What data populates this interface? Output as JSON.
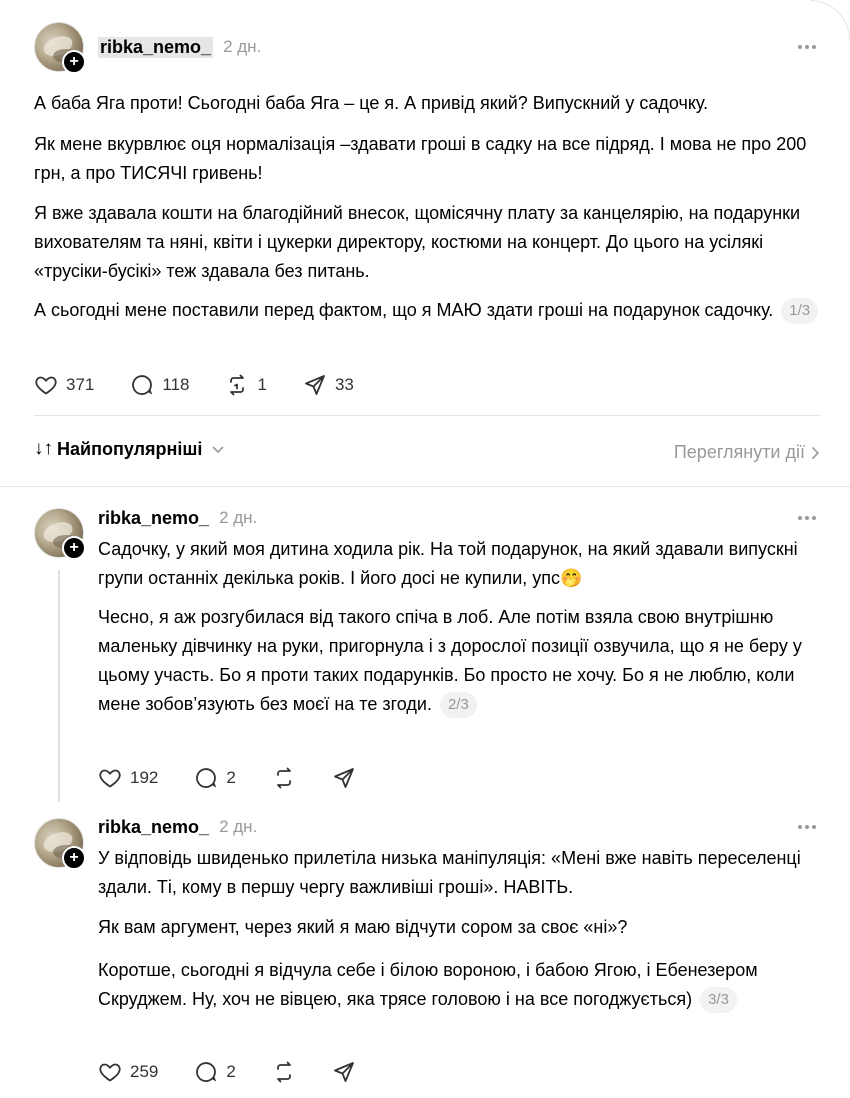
{
  "main_post": {
    "username": "ribka_nemo_",
    "time": "2 дн.",
    "paragraphs": [
      "А баба Яга проти! Сьогодні баба Яга – це я. А привід який? Випускний у садочку.",
      "Як мене вкурвлює оця нормалізація –здавати гроші в садку на все підряд. І мова не про 200 грн, а про ТИСЯЧІ гривень!",
      "Я вже здавала кошти на благодійний внесок, щомісячну плату за канцелярію, на подарунки вихователям та няні, квіти і цукерки директору, костюми на концерт. До цього на усілякі «трусіки-бусікі» теж здавала без питань.",
      "А сьогодні мене поставили перед фактом, що я МАЮ здати гроші на подарунок садочку."
    ],
    "counter": "1/3",
    "likes": "371",
    "comments": "118",
    "reposts": "1",
    "shares": "33"
  },
  "sort_bar": {
    "sort_label": "Найпопулярніші",
    "view_activity": "Переглянути дії"
  },
  "reply_1": {
    "username": "ribka_nemo_",
    "time": "2 дн.",
    "paragraphs": [
      "Садочку, у який моя дитина ходила рік. На той подарунок, на який здавали випускні групи останніх декілька років. І його досі не купили, упс🤭",
      "Чесно, я аж розгубилася від такого спіча в лоб. Але потім взяла свою внутрішню маленьку дівчинку на руки, пригорнула і з дорослої позиції озвучила, що я не беру у цьому участь. Бо я проти таких подарунків. Бо просто не хочу. Бо я не люблю, коли мене зобов’язують без моєї на те згоди."
    ],
    "counter": "2/3",
    "likes": "192",
    "comments": "2"
  },
  "reply_2": {
    "username": "ribka_nemo_",
    "time": "2 дн.",
    "paragraphs": [
      "У відповідь швиденько прилетіла низька маніпуляція: «Мені вже навіть переселенці здали. Ті, кому в першу чергу важливіші гроші». НАВІТЬ.",
      "Як вам аргумент, через який я маю відчути сором за своє «ні»?",
      "Коротше, сьогодні я відчула себе і білою вороною, і бабою Ягою, і Ебенезером Скруджем. Ну, хоч не вівцею, яка трясе головою і на все погоджується)"
    ],
    "counter": "3/3",
    "likes": "259",
    "comments": "2"
  }
}
